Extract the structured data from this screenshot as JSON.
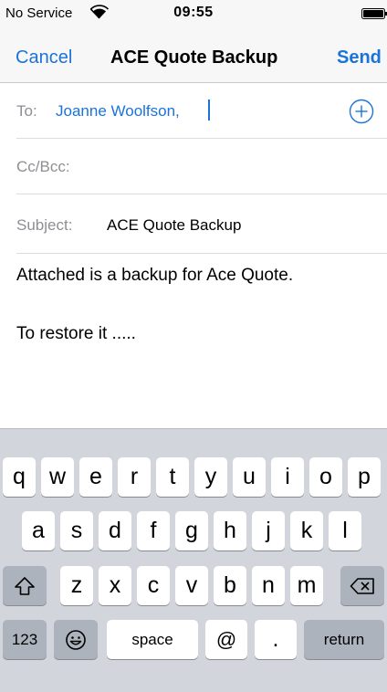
{
  "status_bar": {
    "carrier": "No Service",
    "time": "09:55"
  },
  "nav": {
    "cancel_label": "Cancel",
    "title": "ACE Quote Backup",
    "send_label": "Send"
  },
  "fields": {
    "to_label": "To:",
    "to_value": "Joanne Woolfson,",
    "cc_label": "Cc/Bcc:",
    "subject_label": "Subject:",
    "subject_value": "ACE Quote Backup"
  },
  "body": {
    "line1": "Attached is a backup for Ace Quote.",
    "line2": "To restore it ....."
  },
  "keyboard": {
    "row1": [
      "q",
      "w",
      "e",
      "r",
      "t",
      "y",
      "u",
      "i",
      "o",
      "p"
    ],
    "row2": [
      "a",
      "s",
      "d",
      "f",
      "g",
      "h",
      "j",
      "k",
      "l"
    ],
    "row3": [
      "z",
      "x",
      "c",
      "v",
      "b",
      "n",
      "m"
    ],
    "numbers_label": "123",
    "space_label": "space",
    "at_label": "@",
    "period_label": ".",
    "return_label": "return",
    "icons": {
      "shift": "shift-icon",
      "delete": "delete-icon",
      "emoji": "emoji-icon"
    }
  },
  "colors": {
    "accent": "#1a73d9",
    "keyboard_bg": "#d2d5db",
    "dark_key": "#adb3bc"
  }
}
